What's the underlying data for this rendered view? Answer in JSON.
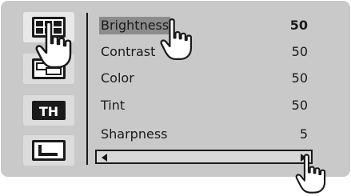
{
  "sidebar": {
    "items": [
      {
        "name": "picture-menu-icon",
        "selected": true
      },
      {
        "name": "screen-menu-icon",
        "selected": false
      },
      {
        "name": "tint-menu-icon",
        "label": "TH",
        "selected": false
      },
      {
        "name": "setup-menu-icon",
        "selected": false
      }
    ]
  },
  "menu": {
    "rows": [
      {
        "label": "Brightness",
        "value": "50",
        "highlighted": true
      },
      {
        "label": "Contrast",
        "value": "50",
        "highlighted": false
      },
      {
        "label": "Color",
        "value": "50",
        "highlighted": false
      },
      {
        "label": "Tint",
        "value": "50",
        "highlighted": false
      },
      {
        "label": "Sharpness",
        "value": "5",
        "highlighted": false
      }
    ]
  },
  "slider": {
    "left_icon": "left-arrow-icon",
    "right_icon": "right-arrow-icon"
  },
  "colors": {
    "panel": "#c9c9c9",
    "highlight": "#8c8c8c",
    "text": "#1a1a1a"
  }
}
